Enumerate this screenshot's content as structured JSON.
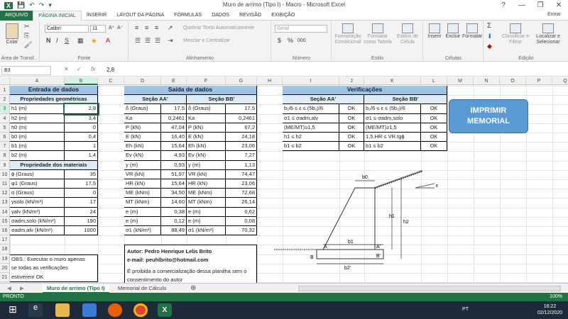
{
  "window": {
    "title": "Muro de arrimo (Tipo I) - Macro - Microsoft Excel",
    "controls": [
      "?",
      "—",
      "❐",
      "✕"
    ]
  },
  "qat": [
    "💾",
    "↶",
    "↷",
    "▾"
  ],
  "ribbon_tabs": [
    "ARQUIVO",
    "PÁGINA INICIAL",
    "INSERIR",
    "LAYOUT DA PÁGINA",
    "FÓRMULAS",
    "DADOS",
    "REVISÃO",
    "EXIBIÇÃO"
  ],
  "account": "Entrar",
  "ribbon": {
    "clipboard": {
      "paste": "Colar",
      "label": "Área de Transf..."
    },
    "font": {
      "name": "Calibri",
      "size": "11",
      "label": "Fonte",
      "grow": "A⁺",
      "shrink": "A⁻",
      "bold": "N",
      "italic": "I",
      "underline": "S"
    },
    "alignment": {
      "wrap": "Quebrar Texto Automaticamente",
      "merge": "Mesclar e Centralizar",
      "label": "Alinhamento"
    },
    "number": {
      "format": "Geral",
      "label": "Número",
      "pct": "%",
      "thousands": "000"
    },
    "styles": {
      "cond": "Formatação Condicional",
      "table": "Formatar como Tabela",
      "cell": "Estilos de Célula",
      "label": "Estilo"
    },
    "cells": {
      "insert": "Inserir",
      "delete": "Excluir",
      "format": "Formatar",
      "label": "Células"
    },
    "editing": {
      "sort": "Classificar e Filtrar",
      "find": "Localizar e Selecionar",
      "label": "Edição"
    }
  },
  "formula_bar": {
    "name_box": "B3",
    "fx": "fx",
    "value": "2,8",
    "cancel": "✕",
    "enter": "✓"
  },
  "columns": [
    "A",
    "B",
    "C",
    "D",
    "E",
    "F",
    "G",
    "H",
    "I",
    "J",
    "K",
    "L",
    "M",
    "N",
    "O",
    "P",
    "Q"
  ],
  "rows": [
    "1",
    "2",
    "3",
    "4",
    "5",
    "6",
    "7",
    "8",
    "9",
    "10",
    "11",
    "12",
    "13",
    "14",
    "15",
    "16",
    "17",
    "18",
    "19",
    "20",
    "21",
    "22",
    "23"
  ],
  "entrada": {
    "title": "Entrada de dados",
    "sub1": "Propriedades geométricas",
    "geo": [
      [
        "h1 (m)",
        "2,8"
      ],
      [
        "h2 (m)",
        "3,4"
      ],
      [
        "h0 (m)",
        "0"
      ],
      [
        "b0 (m)",
        "0,4"
      ],
      [
        "b1 (m)",
        "1"
      ],
      [
        "b2 (m)",
        "1,4"
      ]
    ],
    "sub2": "Propriedade dos materiais",
    "mat": [
      [
        "ϕ (Graus)",
        "35"
      ],
      [
        "φ1 (Graus)",
        "17,5"
      ],
      [
        "α (Graus)",
        "0"
      ],
      [
        "γsolo (kN/m³)",
        "17"
      ],
      [
        "γalv (kN/m³)",
        "24"
      ],
      [
        "σadm,solo (kN/m²)",
        "190"
      ],
      [
        "σadm,alv (kN/m²)",
        "1000"
      ]
    ]
  },
  "saida": {
    "title": "Saída de dados",
    "secA": "Seção AA'",
    "secB": "Seção BB'",
    "rows": [
      [
        "δ (Graus)",
        "17,5",
        "δ (Graus)",
        "17,5"
      ],
      [
        "Ka",
        "0,2461",
        "Ka",
        "0,2461"
      ],
      [
        "P (kN)",
        "47,04",
        "P (kN)",
        "67,2"
      ],
      [
        "E (kN)",
        "16,40",
        "E (kN)",
        "24,18"
      ],
      [
        "Eh (kN)",
        "15,64",
        "Eh (kN)",
        "23,06"
      ],
      [
        "Ev (kN)",
        "4,93",
        "Ev (kN)",
        "7,27"
      ],
      [
        "y (m)",
        "0,93",
        "y (m)",
        "1,13"
      ],
      [
        "VR (kN)",
        "51,97",
        "VR (kN)",
        "74,47"
      ],
      [
        "HR (kN)",
        "15,64",
        "HR (kN)",
        "23,06"
      ],
      [
        "ME (kNm)",
        "34,50",
        "ME (kNm)",
        "72,68"
      ],
      [
        "MT (kNm)",
        "14,60",
        "MT (kNm)",
        "26,14"
      ],
      [
        "e (m)",
        "0,38",
        "e (m)",
        "0,62"
      ],
      [
        "e (m)",
        "0,12",
        "e (m)",
        "0,08"
      ],
      [
        "σ1 (kN/m²)",
        "88,49",
        "σ1 (kN/m²)",
        "70,32"
      ]
    ]
  },
  "verificacoes": {
    "title": "Verificações",
    "secA": "Seção AA'",
    "secB": "Seção BB'",
    "rows": [
      [
        "b₁/6 ≤ ε ≤ (5b₁)/6",
        "OK",
        "b₂/6 ≤ ε ≤ (5b₂)/6",
        "OK"
      ],
      [
        "σ1 ≤ σadm,alv",
        "OK",
        "σ1 ≤ σadm,solo",
        "OK"
      ],
      [
        "(ME/MT)≥1,5",
        "OK",
        "(ME/MT)≥1,5",
        "OK"
      ],
      [
        "h1 ≤ h2",
        "OK",
        "1,5.HR ≤ VR.tgϕ",
        "OK"
      ],
      [
        "b1 ≤ b2",
        "OK",
        "b1 ≤ b2",
        "OK"
      ]
    ]
  },
  "obs1": [
    "OBS.: Executar o muro apenas",
    "se todas as verificações",
    "estiverem OK"
  ],
  "obs2": [
    "OBS.: Prever sistema de"
  ],
  "autor": {
    "line1": "Autor: Pedro Henrique Lelis Brito",
    "line2": "e-mail: peuhlbrito@hotmail.com",
    "line3": "É proibida a comercialização dessa planilha sem o",
    "line4": "consentimento do autor"
  },
  "button": {
    "line1": "IMPRIMIR",
    "line2": "MEMORIAL"
  },
  "diagram": {
    "b0": "b0",
    "b1": "b1",
    "b2": "b2'",
    "h1": "h1",
    "h2": "h2",
    "A": "A",
    "A2": "A'",
    "B": "B",
    "B2": "B'",
    "eps": "ε"
  },
  "sheets": [
    "Muro de arrimo (Tipo I)",
    "Memorial de Cálculo"
  ],
  "status": {
    "left": "PRONTO",
    "zoom": "100%"
  },
  "clock": {
    "time": "16:22",
    "date": "02/12/2020",
    "lang": "PT"
  }
}
